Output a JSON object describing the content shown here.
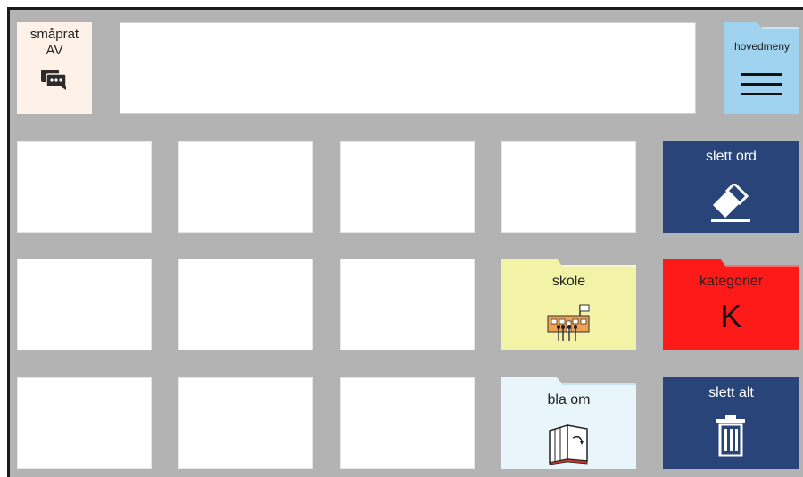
{
  "talk": {
    "line1": "småprat",
    "line2": "AV",
    "icon": "chat-bubbles-icon"
  },
  "menu": {
    "label": "hovedmeny",
    "icon": "hamburger-menu-icon",
    "color": "#9fd3ef"
  },
  "buttons": {
    "delete_word": {
      "label": "slett ord",
      "icon": "eraser-icon"
    },
    "school": {
      "label": "skole",
      "icon": "school-building-icon",
      "color": "#f2f3a6"
    },
    "categories": {
      "label": "kategorier",
      "letter": "K",
      "icon": "letter-k-icon",
      "color": "#ff1a1a"
    },
    "turn_page": {
      "label": "bla om",
      "icon": "open-book-icon",
      "color": "#e8f6fb"
    },
    "delete_all": {
      "label": "slett alt",
      "icon": "trash-can-icon"
    }
  },
  "colors": {
    "navy": "#284478",
    "grid_bg": "#b3b3b3"
  }
}
